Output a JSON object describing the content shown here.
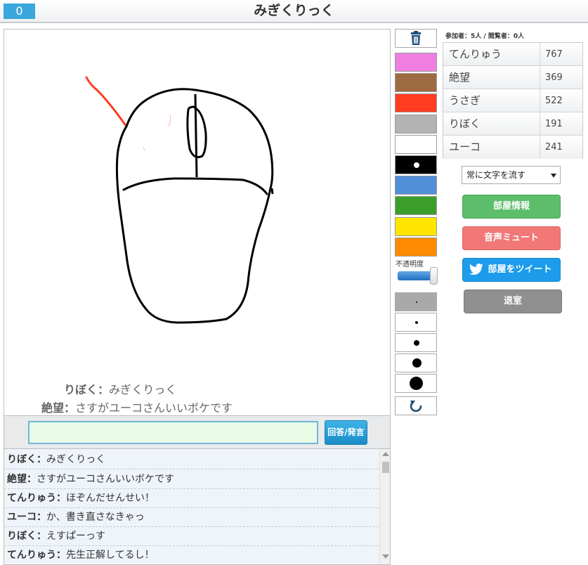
{
  "header": {
    "counter": "0",
    "title": "みぎくりっく"
  },
  "canvas": {
    "overlay_messages": [
      {
        "name": "りぼく：",
        "text": "みぎくりっく"
      },
      {
        "name": "絶望：",
        "text": "さすがユーコさんいいボケです"
      }
    ]
  },
  "answer": {
    "input_value": "",
    "button_label": "回答/発言"
  },
  "chat": [
    {
      "name": "りぼく：",
      "text": "みぎくりっく"
    },
    {
      "name": "絶望：",
      "text": "さすがユーコさんいいボケです"
    },
    {
      "name": "てんりゅう：",
      "text": "ほぞんだせんせい！"
    },
    {
      "name": "ユーコ：",
      "text": "か、書き直さなきゃっ"
    },
    {
      "name": "りぼく：",
      "text": "えすぱーっす"
    },
    {
      "name": "てんりゅう：",
      "text": "先生正解してるし！"
    }
  ],
  "tools": {
    "trash_icon": "trash-icon",
    "colors": [
      "#f07ee0",
      "#9e6a40",
      "#ff3b22",
      "#b3b3b3",
      "#ffffff",
      "#000000",
      "#4f90d9",
      "#3c9e2a",
      "#ffe600",
      "#ff8c00"
    ],
    "opacity_label": "不透明度",
    "opacity_value": 1.0,
    "undo_icon": "undo-icon"
  },
  "sidebar": {
    "participants": "参加者：5人 / 閲覧者：0人",
    "scores": [
      {
        "name": "てんりゅう",
        "score": "767"
      },
      {
        "name": "絶望",
        "score": "369"
      },
      {
        "name": "うさぎ",
        "score": "522"
      },
      {
        "name": "りぼく",
        "score": "191"
      },
      {
        "name": "ユーコ",
        "score": "241"
      }
    ],
    "text_flow_select": "常に文字を流す",
    "room_info_label": "部屋情報",
    "mute_label": "音声ミュート",
    "tweet_label": "部屋をツイート",
    "exit_label": "退室"
  }
}
